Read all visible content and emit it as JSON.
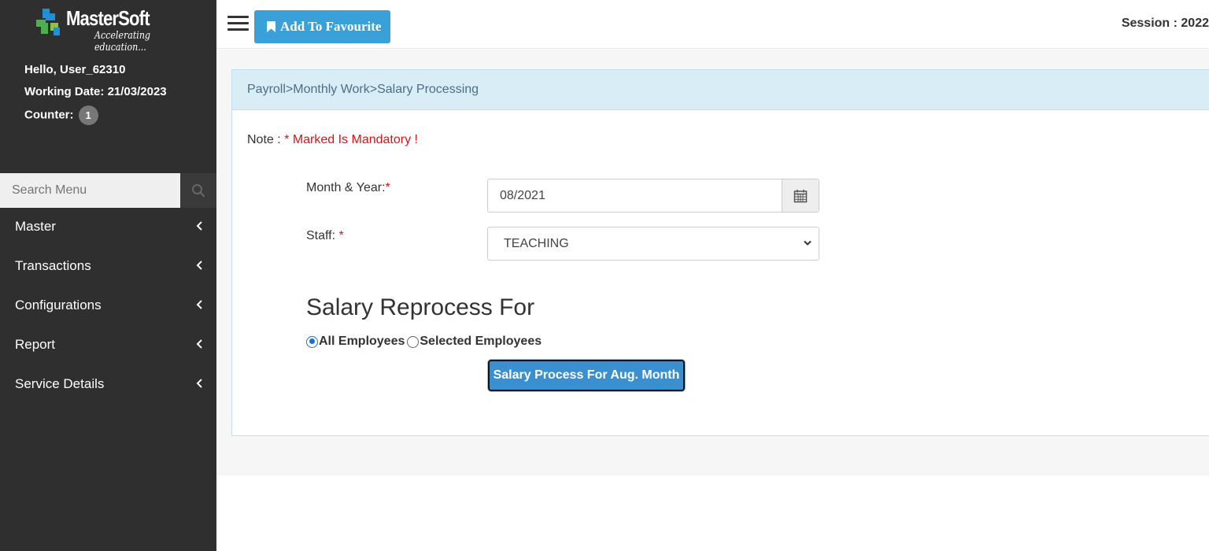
{
  "brand": {
    "name": "MasterSoft",
    "tagline": "Accelerating education..."
  },
  "user": {
    "greeting": "Hello, User_62310",
    "working_date": "Working Date: 21/03/2023",
    "counter_label": "Counter:",
    "counter_value": "1"
  },
  "search": {
    "placeholder": "Search Menu"
  },
  "menu": [
    {
      "label": "Master"
    },
    {
      "label": "Transactions"
    },
    {
      "label": "Configurations"
    },
    {
      "label": "Report"
    },
    {
      "label": "Service Details"
    }
  ],
  "topbar": {
    "favourite_label": "Add To Favourite",
    "session": "Session : 2022"
  },
  "page": {
    "breadcrumb": "Payroll>Monthly Work>Salary Processing",
    "note_label": "Note :",
    "note_text": "* Marked Is Mandatory !"
  },
  "form": {
    "month_label": "Month & Year:",
    "month_value": "08/2021",
    "staff_label": "Staff:",
    "staff_value": "TEACHING",
    "required_mark": "*",
    "section_title": "Salary Reprocess For",
    "radio_all": "All Employees",
    "radio_selected": "Selected Employees",
    "radio_checked": "All Employees",
    "process_button": "Salary Process For Aug. Month"
  },
  "colors": {
    "sidebar": "#2f2f2f",
    "accent": "#3aa0d8",
    "panel_header": "#d9edf6",
    "required": "#dd1111"
  }
}
